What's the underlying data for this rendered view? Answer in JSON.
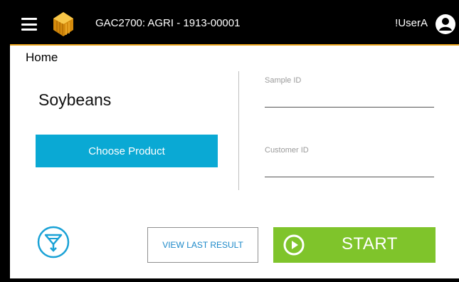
{
  "header": {
    "title": "GAC2700: AGRI - 1913-00001",
    "user": "!UserA",
    "menu_icon": "hamburger-menu-icon",
    "logo_icon": "app-logo-icon",
    "user_icon": "account-circle-icon"
  },
  "breadcrumb": "Home",
  "product": {
    "name": "Soybeans",
    "choose_label": "Choose Product"
  },
  "fields": {
    "sample_id": {
      "label": "Sample ID",
      "value": ""
    },
    "customer_id": {
      "label": "Customer ID",
      "value": ""
    }
  },
  "actions": {
    "funnel_icon": "funnel-icon",
    "view_last_label": "VIEW LAST RESULT",
    "start_label": "START",
    "start_icon": "play-circle-icon"
  },
  "colors": {
    "accent_line": "#e8a21b",
    "choose_button": "#0aa9d4",
    "start_button": "#7fc42b",
    "link_text": "#1c89c9"
  }
}
